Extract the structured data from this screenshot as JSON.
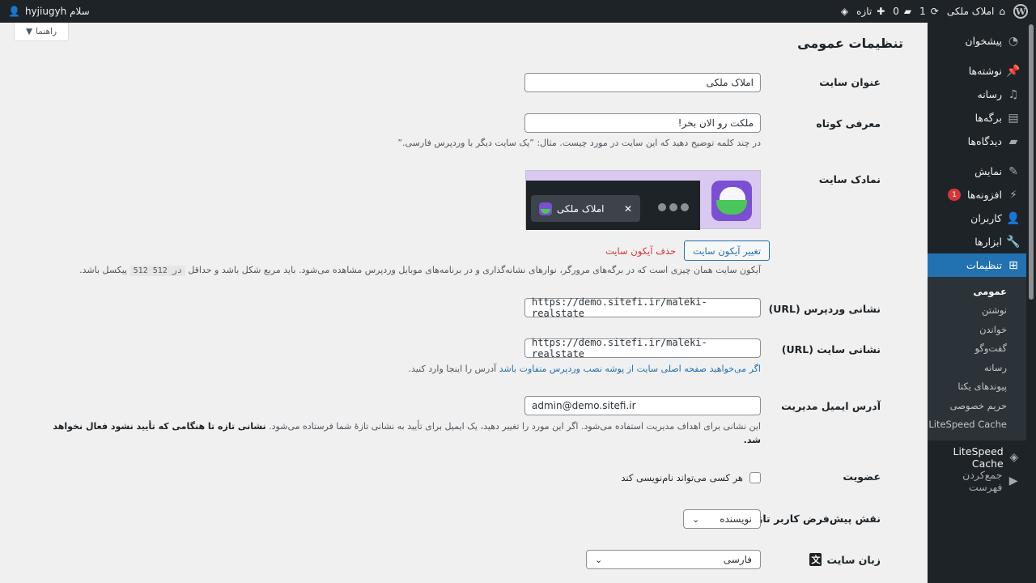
{
  "adminbar": {
    "site_name": "املاک ملکی",
    "updates": "1",
    "comments": "0",
    "new_label": "تازه",
    "greeting": "سلام hyjiugyh"
  },
  "help_tab": {
    "label": "راهنما"
  },
  "sidebar": {
    "items": [
      {
        "label": "پیشخوان",
        "icon": "dashboard-icon"
      },
      {
        "label": "نوشته‌ها",
        "icon": "pin-icon"
      },
      {
        "label": "رسانه",
        "icon": "media-icon"
      },
      {
        "label": "برگه‌ها",
        "icon": "page-icon"
      },
      {
        "label": "دیدگاه‌ها",
        "icon": "comment-icon"
      },
      {
        "label": "نمایش",
        "icon": "brush-icon"
      },
      {
        "label": "افزونه‌ها",
        "icon": "plugin-icon",
        "badge": "1"
      },
      {
        "label": "کاربران",
        "icon": "users-icon"
      },
      {
        "label": "ابزارها",
        "icon": "tools-icon"
      },
      {
        "label": "تنظیمات",
        "icon": "settings-icon",
        "active": true
      }
    ],
    "submenu": [
      "عمومی",
      "نوشتن",
      "خواندن",
      "گفت‌وگو",
      "رسانه",
      "پیوندهای یکتا",
      "حریم خصوصی",
      "LiteSpeed Cache"
    ],
    "extra": [
      {
        "label": "LiteSpeed Cache",
        "icon": "diamond-icon"
      },
      {
        "label": "جمع‌کردن فهرست",
        "icon": "collapse-icon"
      }
    ]
  },
  "page": {
    "title": "تنظیمات عمومی",
    "site_title_label": "عنوان سایت",
    "site_title_value": "املاک ملکی",
    "tagline_label": "معرفی کوتاه",
    "tagline_value": "ملکت رو الان بخر!",
    "tagline_desc": "در چند کلمه توضیح دهید که این سایت در مورد چیست. مثال: ”یک سایت دیگر با وردپرس فارسی.”",
    "site_icon_label": "نمادک سایت",
    "site_icon_tab_text": "املاک ملکی",
    "change_icon_button": "تغییر آیکون سایت",
    "remove_icon_link": "حذف آیکون سایت",
    "site_icon_desc_1": "آیکون سایت همان چیزی است که در برگه‌های مرورگر، نوارهای نشانه‌گذاری و در برنامه‌های موبایل وردپرس مشاهده می‌شود. باید مربع شکل باشد و حداقل",
    "site_icon_desc_code": "512 در 512",
    "site_icon_desc_2": "پیکسل باشد.",
    "wp_url_label": "نشانی وردپرس (URL)",
    "wp_url_value": "https://demo.sitefi.ir/maleki-realstate",
    "site_url_label": "نشانی سایت (URL)",
    "site_url_value": "https://demo.sitefi.ir/maleki-realstate",
    "site_url_desc_link": "اگر می‌خواهید صفحه اصلی سایت از پوشه نصب وردپرس متفاوت باشد",
    "site_url_desc_rest": "آدرس را اینجا وارد کنید.",
    "admin_email_label": "آدرس ایمیل مدیریت",
    "admin_email_value": "admin@demo.sitefi.ir",
    "admin_email_desc": "این نشانی برای اهداف مدیریت استفاده می‌شود. اگر این مورد را تغییر دهید، یک ایمیل برای تأیید به نشانی تازهٔ شما فرستاده می‌شود.",
    "admin_email_desc_bold": "نشانی تازه تا هنگامی که تأیید نشود فعال نخواهد شد.",
    "membership_label": "عضویت",
    "membership_checkbox": "هر کسی می‌تواند نام‌نویسی کند",
    "default_role_label": "نقش پیش‌فرض کاربر تازه",
    "default_role_value": "نویسنده",
    "language_label": "زبان سایت",
    "language_value": "فارسی"
  }
}
